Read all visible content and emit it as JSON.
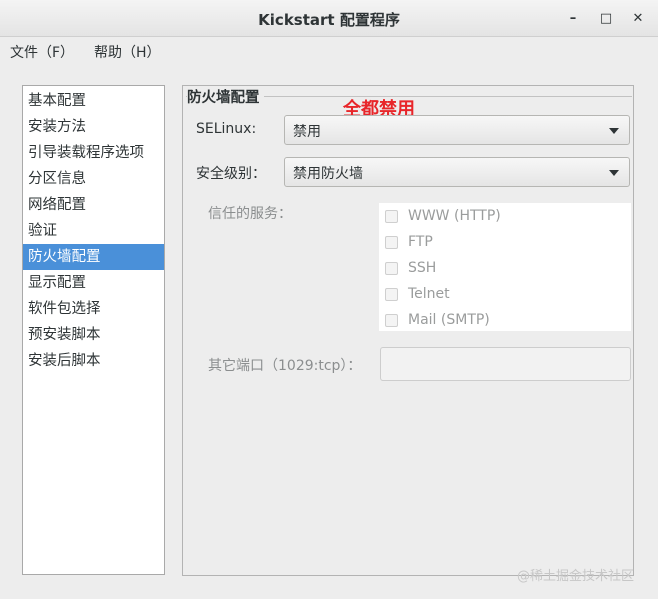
{
  "window": {
    "title": "Kickstart 配置程序",
    "minimize_symbol": "–",
    "maximize_symbol": "□",
    "close_symbol": "✕"
  },
  "menu": {
    "file": "文件（F）",
    "help": "帮助（H）"
  },
  "sidebar": {
    "items": [
      {
        "label": "基本配置"
      },
      {
        "label": "安装方法"
      },
      {
        "label": "引导装载程序选项"
      },
      {
        "label": "分区信息"
      },
      {
        "label": "网络配置"
      },
      {
        "label": "验证"
      },
      {
        "label": "防火墙配置",
        "selected": true
      },
      {
        "label": "显示配置"
      },
      {
        "label": "软件包选择"
      },
      {
        "label": "预安装脚本"
      },
      {
        "label": "安装后脚本"
      }
    ]
  },
  "firewall": {
    "section_title": "防火墙配置",
    "annotation": "全都禁用",
    "selinux_label": "SELinux:",
    "selinux_value": "禁用",
    "security_label": "安全级别：",
    "security_value": "禁用防火墙",
    "trusted_label": "信任的服务：",
    "services": [
      {
        "label": "WWW (HTTP)",
        "checked": false
      },
      {
        "label": "FTP",
        "checked": false
      },
      {
        "label": "SSH",
        "checked": false
      },
      {
        "label": "Telnet",
        "checked": false
      },
      {
        "label": "Mail (SMTP)",
        "checked": false
      }
    ],
    "other_ports_label": "其它端口（1029:tcp）：",
    "other_ports_value": ""
  },
  "watermark": "@稀土掘金技术社区",
  "colors": {
    "selection": "#4a90d9",
    "annotation": "#e8262a"
  }
}
